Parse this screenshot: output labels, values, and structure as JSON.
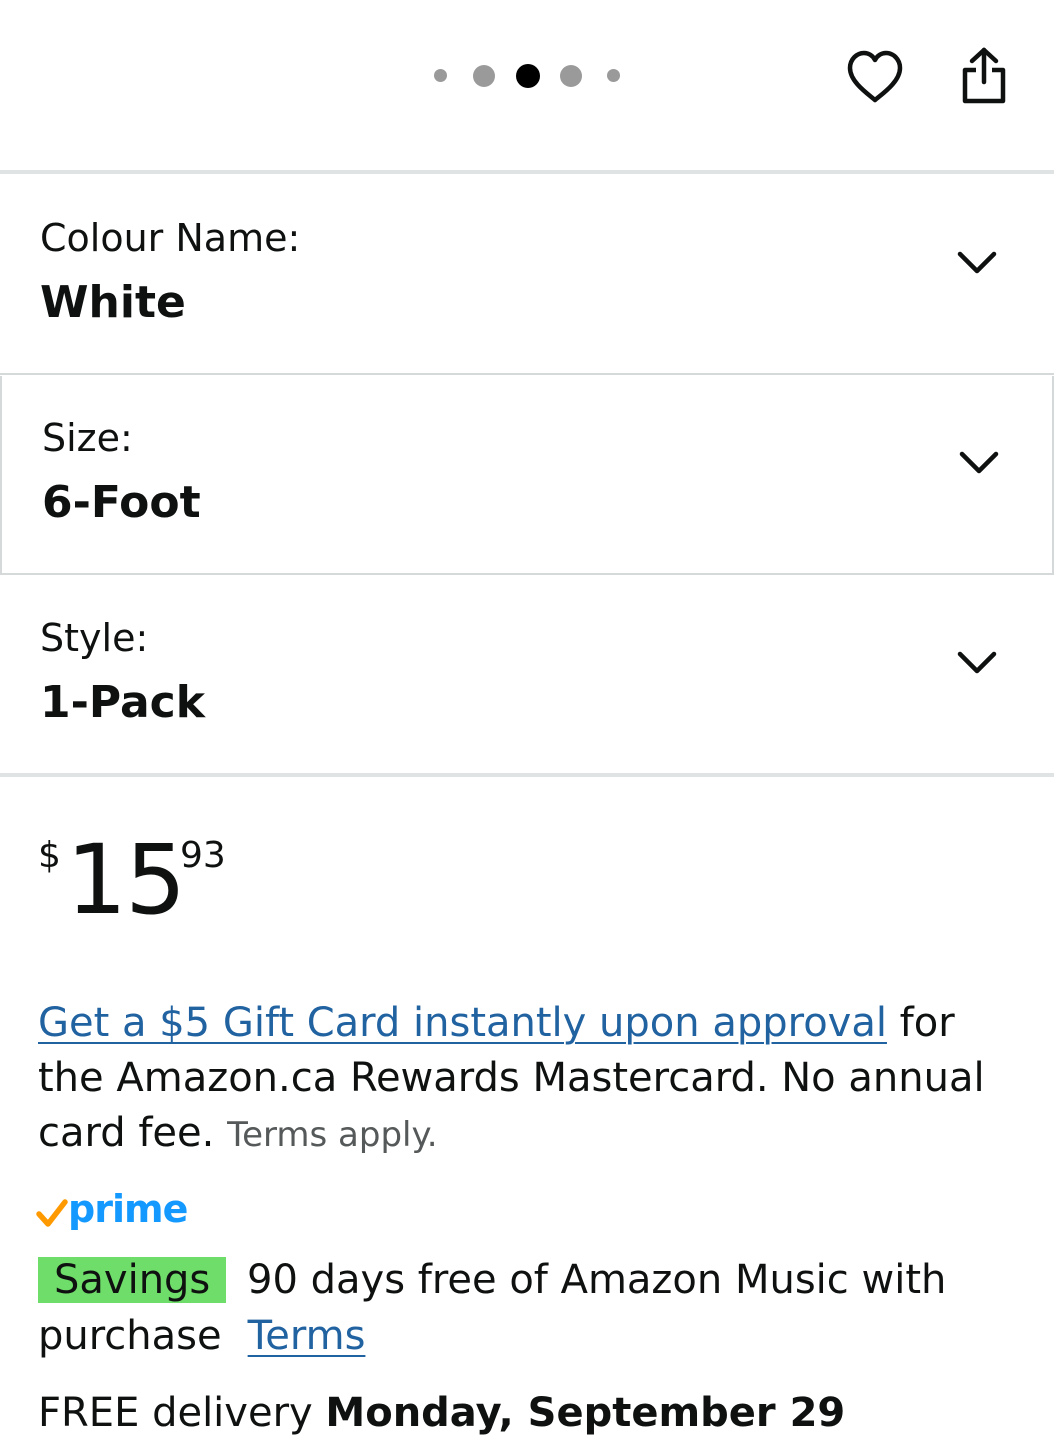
{
  "gallery": {
    "dot_count": 5,
    "active_dot": 3
  },
  "icons": {
    "wishlist": "heart-icon",
    "share": "share-icon",
    "dropdown": "chevron-down-icon",
    "prime_check": "checkmark-icon"
  },
  "variations": [
    {
      "label": "Colour Name:",
      "value": "White"
    },
    {
      "label": "Size:",
      "value": "6-Foot"
    },
    {
      "label": "Style:",
      "value": "1-Pack"
    }
  ],
  "price": {
    "currency": "$",
    "whole": "15",
    "fraction": "93"
  },
  "promo": {
    "link_text": "Get a $5 Gift Card instantly upon approval",
    "text": " for the Amazon.ca Rewards Mastercard. No annual card fee.",
    "terms": "Terms apply."
  },
  "prime": {
    "logo_text": "prime",
    "badge": "Savings",
    "offer_text": "90 days free of Amazon Music with purchase",
    "terms_link": "Terms"
  },
  "delivery": {
    "prefix": "FREE delivery ",
    "date": "Monday, September 29"
  },
  "colors": {
    "link": "#2162a1",
    "prime_blue": "#1399ff",
    "prime_check": "#ff9900",
    "savings_badge": "#6fdd6a",
    "dot_active": "#000000",
    "dot_inactive": "#9a9a9a",
    "divider": "#d5d9d9",
    "text": "#0f1111"
  }
}
